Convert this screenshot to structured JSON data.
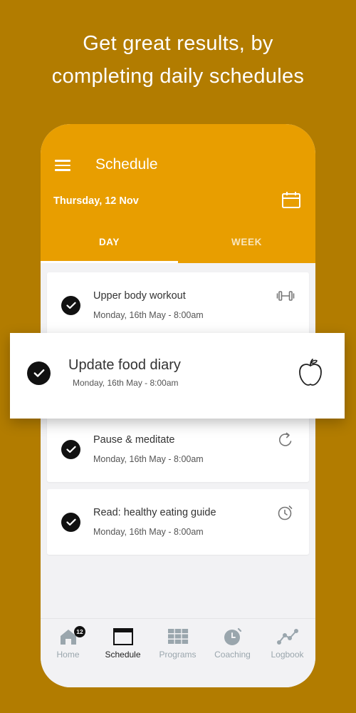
{
  "headline": {
    "line1": "Get great results, by",
    "line2": "completing daily schedules"
  },
  "colors": {
    "background": "#B27C00",
    "accent": "#E89E00",
    "surface": "#F2F2F4",
    "check": "#111111"
  },
  "appbar": {
    "menu_icon": "hamburger-menu-icon",
    "title": "Schedule",
    "date": "Thursday, 12 Nov",
    "calendar_icon": "calendar-icon",
    "tabs": [
      {
        "label": "DAY",
        "active": true
      },
      {
        "label": "WEEK",
        "active": false
      }
    ]
  },
  "tasks": [
    {
      "title": "Upper body workout",
      "time": "Monday, 16th May - 8:00am",
      "icon": "dumbbell-icon",
      "done": true
    },
    {
      "title": "Pause & meditate",
      "time": "Monday, 16th May - 8:00am",
      "icon": "refresh-icon",
      "done": true
    },
    {
      "title": "Read: healthy eating guide",
      "time": "Monday, 16th May - 8:00am",
      "icon": "alarm-clock-icon",
      "done": true
    }
  ],
  "highlight": {
    "title": "Update food diary",
    "time": "Monday, 16th May - 8:00am",
    "icon": "apple-icon",
    "done": true
  },
  "bottom_nav": {
    "items": [
      {
        "label": "Home",
        "icon": "home-icon",
        "badge": "12",
        "active": false
      },
      {
        "label": "Schedule",
        "icon": "calendar-icon",
        "active": true
      },
      {
        "label": "Programs",
        "icon": "grid-icon",
        "active": false
      },
      {
        "label": "Coaching",
        "icon": "stopwatch-icon",
        "active": false
      },
      {
        "label": "Logbook",
        "icon": "line-chart-icon",
        "active": false
      }
    ]
  }
}
